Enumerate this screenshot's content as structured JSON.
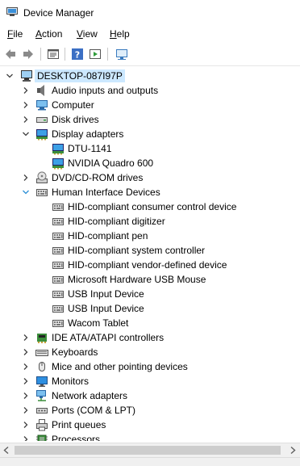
{
  "window": {
    "title": "Device Manager"
  },
  "menu": [
    {
      "label": "File",
      "key": "F",
      "rest": "ile"
    },
    {
      "label": "Action",
      "key": "A",
      "rest": "ction"
    },
    {
      "label": "View",
      "key": "V",
      "rest": "iew"
    },
    {
      "label": "Help",
      "key": "H",
      "rest": "elp"
    }
  ],
  "toolbar": [
    "back-arrow-icon",
    "forward-arrow-icon",
    "properties-icon",
    "help-icon",
    "run-icon",
    "monitor-scan-icon"
  ],
  "tree": {
    "root": "DESKTOP-087I97P",
    "nodes": [
      {
        "label": "Audio inputs and outputs",
        "icon": "speaker-icon",
        "state": "collapsed",
        "level": 1
      },
      {
        "label": "Computer",
        "icon": "computer-icon",
        "state": "collapsed",
        "level": 1
      },
      {
        "label": "Disk drives",
        "icon": "disk-drive-icon",
        "state": "collapsed",
        "level": 1
      },
      {
        "label": "Display adapters",
        "icon": "display-adapter-icon",
        "state": "expanded",
        "level": 1
      },
      {
        "label": "DTU-1141",
        "icon": "display-adapter-icon",
        "state": "leaf",
        "level": 2
      },
      {
        "label": "NVIDIA Quadro 600",
        "icon": "display-adapter-icon",
        "state": "leaf",
        "level": 2
      },
      {
        "label": "DVD/CD-ROM drives",
        "icon": "dvd-icon",
        "state": "collapsed",
        "level": 1
      },
      {
        "label": "Human Interface Devices",
        "icon": "hid-icon",
        "state": "expanded",
        "level": 1
      },
      {
        "label": "HID-compliant consumer control device",
        "icon": "hid-icon",
        "state": "leaf",
        "level": 2
      },
      {
        "label": "HID-compliant digitizer",
        "icon": "hid-icon",
        "state": "leaf",
        "level": 2
      },
      {
        "label": "HID-compliant pen",
        "icon": "hid-icon",
        "state": "leaf",
        "level": 2
      },
      {
        "label": "HID-compliant system controller",
        "icon": "hid-icon",
        "state": "leaf",
        "level": 2
      },
      {
        "label": "HID-compliant vendor-defined device",
        "icon": "hid-icon",
        "state": "leaf",
        "level": 2
      },
      {
        "label": "Microsoft Hardware USB Mouse",
        "icon": "hid-icon",
        "state": "leaf",
        "level": 2
      },
      {
        "label": "USB Input Device",
        "icon": "hid-icon",
        "state": "leaf",
        "level": 2
      },
      {
        "label": "USB Input Device",
        "icon": "hid-icon",
        "state": "leaf",
        "level": 2
      },
      {
        "label": "Wacom Tablet",
        "icon": "hid-icon",
        "state": "leaf",
        "level": 2
      },
      {
        "label": "IDE ATA/ATAPI controllers",
        "icon": "ide-controller-icon",
        "state": "collapsed",
        "level": 1
      },
      {
        "label": "Keyboards",
        "icon": "keyboard-icon",
        "state": "collapsed",
        "level": 1
      },
      {
        "label": "Mice and other pointing devices",
        "icon": "mouse-icon",
        "state": "collapsed",
        "level": 1
      },
      {
        "label": "Monitors",
        "icon": "monitor-icon",
        "state": "collapsed",
        "level": 1
      },
      {
        "label": "Network adapters",
        "icon": "network-icon",
        "state": "collapsed",
        "level": 1
      },
      {
        "label": "Ports (COM & LPT)",
        "icon": "port-icon",
        "state": "collapsed",
        "level": 1
      },
      {
        "label": "Print queues",
        "icon": "printer-icon",
        "state": "collapsed",
        "level": 1
      },
      {
        "label": "Processors",
        "icon": "processor-icon",
        "state": "collapsed",
        "level": 1
      }
    ]
  },
  "colors": {
    "selection": "#cce8ff",
    "accent": "#1e90d6",
    "expand_blue": "#2b8fd6"
  }
}
